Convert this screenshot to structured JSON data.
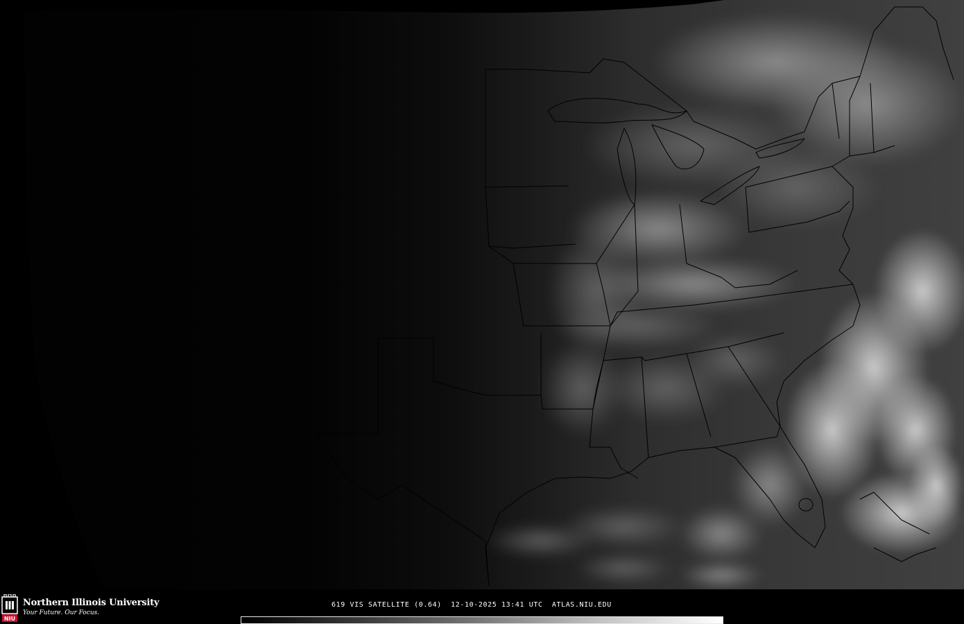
{
  "caption": {
    "product": "619 VIS SATELLITE (0.64)",
    "datetime": "12-10-2025 13:41 UTC",
    "source": "ATLAS.NIU.EDU"
  },
  "branding": {
    "name": "Northern Illinois University",
    "tagline": "Your Future. Our Focus.",
    "logo_text": "NIU"
  },
  "colors": {
    "background": "#000000",
    "boundary_lines": "#000000",
    "text": "#ffffff",
    "logo_red": "#c8102e"
  },
  "map": {
    "region": "Eastern and Central United States",
    "channel": "visible 0.64",
    "illumination": "day-night terminator across central US"
  }
}
